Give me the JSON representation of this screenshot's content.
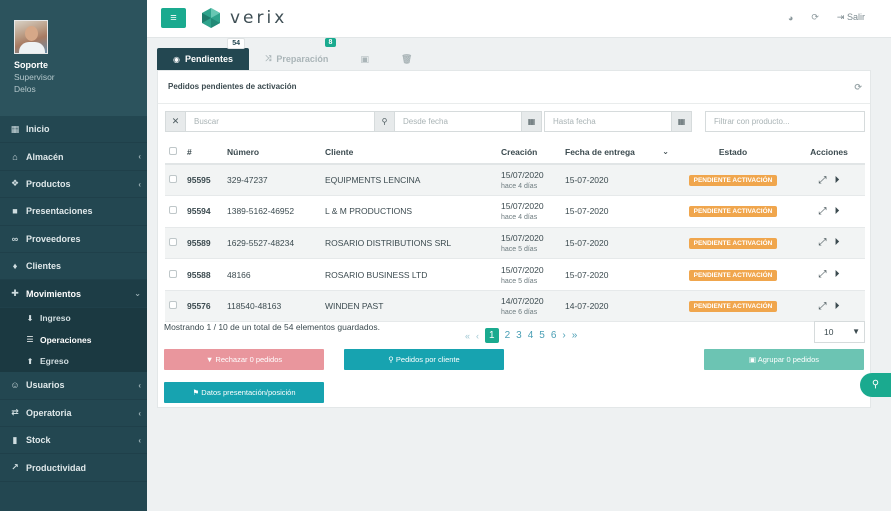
{
  "profile": {
    "name": "Soporte",
    "role": "Supervisor",
    "org": "Delos"
  },
  "sidebar": {
    "items": [
      {
        "label": "Inicio",
        "icon": "chart-icon",
        "glyph": "▦",
        "chev": ""
      },
      {
        "label": "Almacén",
        "icon": "warehouse-icon",
        "glyph": "⌂",
        "chev": "‹"
      },
      {
        "label": "Productos",
        "icon": "products-icon",
        "glyph": "❖",
        "chev": "‹"
      },
      {
        "label": "Presentaciones",
        "icon": "box-icon",
        "glyph": "■",
        "chev": ""
      },
      {
        "label": "Proveedores",
        "icon": "handshake-icon",
        "glyph": "∞",
        "chev": ""
      },
      {
        "label": "Clientes",
        "icon": "user-icon",
        "glyph": "♦",
        "chev": ""
      },
      {
        "label": "Movimientos",
        "icon": "arrows-icon",
        "glyph": "✚",
        "chev": "⌄"
      }
    ],
    "sub": [
      {
        "label": "Ingreso",
        "glyph": "⬇"
      },
      {
        "label": "Operaciones",
        "glyph": "☰"
      },
      {
        "label": "Egreso",
        "glyph": "⬆"
      }
    ],
    "items2": [
      {
        "label": "Usuarios",
        "icon": "users-icon",
        "glyph": "☺",
        "chev": "‹"
      },
      {
        "label": "Operatoria",
        "icon": "exchange-icon",
        "glyph": "⇄",
        "chev": "‹"
      },
      {
        "label": "Stock",
        "icon": "stock-icon",
        "glyph": "▮",
        "chev": "‹"
      },
      {
        "label": "Productividad",
        "icon": "line-chart-icon",
        "glyph": "↗",
        "chev": ""
      }
    ]
  },
  "topbar": {
    "menu_glyph": "≡",
    "brand": "verix",
    "logout": "Salir"
  },
  "tabs": [
    {
      "label": "Pendientes",
      "badge": "54"
    },
    {
      "label": "Preparación",
      "badge": "8"
    }
  ],
  "panel": {
    "title": "Pedidos pendientes de activación"
  },
  "filters": {
    "search_placeholder": "Buscar",
    "from_placeholder": "Desde fecha",
    "to_placeholder": "Hasta fecha",
    "product_placeholder": "Filtrar con producto..."
  },
  "table": {
    "headers": {
      "hash": "#",
      "numero": "Número",
      "cliente": "Cliente",
      "creacion": "Creación",
      "entrega": "Fecha de entrega",
      "estado": "Estado",
      "acciones": "Acciones"
    },
    "rows": [
      {
        "id": "95595",
        "numero": "329-47237",
        "cliente": "EQUIPMENTS LENCINA",
        "creacion": "15/07/2020",
        "hace": "hace 4 días",
        "entrega": "15-07-2020",
        "estado": "PENDIENTE ACTIVACIÓN"
      },
      {
        "id": "95594",
        "numero": "1389-5162-46952",
        "cliente": "L & M PRODUCTIONS",
        "creacion": "15/07/2020",
        "hace": "hace 4 días",
        "entrega": "15-07-2020",
        "estado": "PENDIENTE ACTIVACIÓN"
      },
      {
        "id": "95589",
        "numero": "1629-5527-48234",
        "cliente": "ROSARIO DISTRIBUTIONS SRL",
        "creacion": "15/07/2020",
        "hace": "hace 5 días",
        "entrega": "15-07-2020",
        "estado": "PENDIENTE ACTIVACIÓN"
      },
      {
        "id": "95588",
        "numero": "48166",
        "cliente": "ROSARIO BUSINESS LTD",
        "creacion": "15/07/2020",
        "hace": "hace 5 días",
        "entrega": "15-07-2020",
        "estado": "PENDIENTE ACTIVACIÓN"
      },
      {
        "id": "95576",
        "numero": "118540-48163",
        "cliente": "WINDEN PAST",
        "creacion": "14/07/2020",
        "hace": "hace 6 días",
        "entrega": "14-07-2020",
        "estado": "PENDIENTE ACTIVACIÓN"
      }
    ]
  },
  "footer": {
    "summary": "Mostrando 1 / 10 de un total de 54 elementos guardados.",
    "pages": [
      "1",
      "2",
      "3",
      "4",
      "5",
      "6"
    ],
    "current_page": "1",
    "per_page": "10"
  },
  "buttons": {
    "reject": "Rechazar 0 pedidos",
    "by_client": "Pedidos por cliente",
    "group": "Agrupar 0 pedidos",
    "data": "Datos presentación/posición"
  },
  "colors": {
    "accent": "#1aaa8f",
    "sidebar": "#234751",
    "status": "#f0a64d",
    "danger": "#e9969d",
    "info": "#17a3b0"
  }
}
